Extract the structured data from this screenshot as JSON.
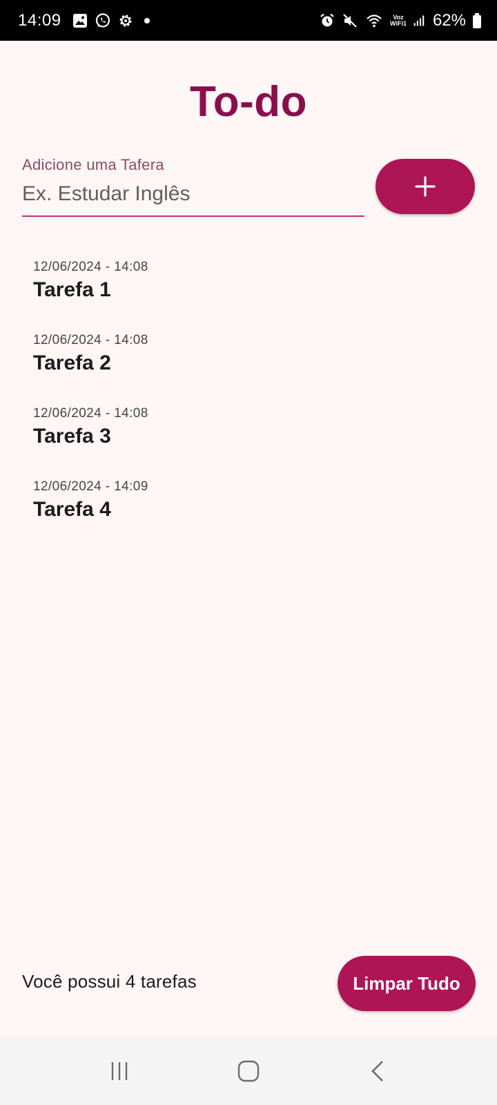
{
  "status_bar": {
    "time": "14:09",
    "left_icons": [
      "gallery-icon",
      "whatsapp-icon",
      "settings-icon",
      "notification-dot"
    ],
    "right_icons": [
      "alarm-icon",
      "mute-icon",
      "wifi-icon",
      "voz-wifi-icon",
      "signal-icon",
      "battery-icon"
    ],
    "voz_line1": "Voz",
    "voz_line2": "WiFi1",
    "battery": "62%"
  },
  "app": {
    "title": "To-do"
  },
  "input": {
    "label": "Adicione uma Tafera",
    "placeholder": "Ex. Estudar Inglês",
    "value": ""
  },
  "add_button": {
    "icon": "plus-icon"
  },
  "tasks": [
    {
      "date": "12/06/2024 - 14:08",
      "title": "Tarefa 1"
    },
    {
      "date": "12/06/2024 - 14:08",
      "title": "Tarefa 2"
    },
    {
      "date": "12/06/2024 - 14:08",
      "title": "Tarefa 3"
    },
    {
      "date": "12/06/2024 - 14:09",
      "title": "Tarefa 4"
    }
  ],
  "footer": {
    "count_text": "Você possui 4 tarefas",
    "clear_label": "Limpar Tudo"
  },
  "nav_bar": {
    "buttons": [
      "recent-apps-icon",
      "home-icon",
      "back-icon"
    ]
  },
  "colors": {
    "accent": "#AE1555",
    "title": "#8A0E4C",
    "background": "#FFF7F6"
  }
}
